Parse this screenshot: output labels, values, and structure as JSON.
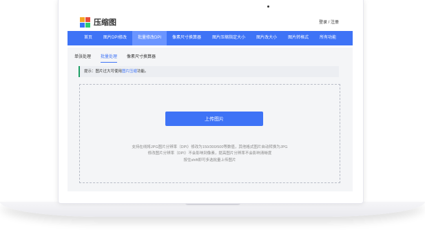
{
  "header": {
    "logo_text": "压缩图",
    "login": "登录 / 注册"
  },
  "nav": {
    "items": [
      {
        "label": "首页",
        "active": false
      },
      {
        "label": "图片DPI修改",
        "active": false
      },
      {
        "label": "批量修改DPI",
        "active": true
      },
      {
        "label": "像素尺寸换算器",
        "active": false
      },
      {
        "label": "图片压缩指定大小",
        "active": false
      },
      {
        "label": "图片改大小",
        "active": false
      },
      {
        "label": "图片转格式",
        "active": false
      },
      {
        "label": "所有功能",
        "active": false
      }
    ]
  },
  "subtabs": [
    {
      "label": "单张处理",
      "active": false
    },
    {
      "label": "批量处理",
      "active": true
    },
    {
      "label": "像素尺寸换算器",
      "active": false
    }
  ],
  "tip": {
    "prefix": "提示：图片过大可使用",
    "link": "图片压缩",
    "suffix": "功能。"
  },
  "upload": {
    "button_label": "上传图片",
    "desc_line1": "支持在线将JPG图片分辨率（DPI）修改为150/300/500等数值，其他格式图片自动转换为JPG",
    "desc_line2": "修改图片分辨率（DPI）不会影响到像素，提高图片分辨率不会影响清晰度",
    "desc_line3": "按住shift即可多选批量上传图片"
  },
  "colors": {
    "accent": "#3e73f6",
    "tip_border": "#1a9e63"
  }
}
